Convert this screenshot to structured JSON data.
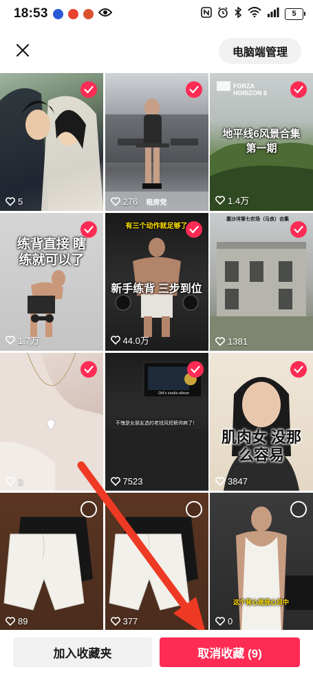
{
  "status_bar": {
    "time": "18:53",
    "battery": "5"
  },
  "header": {
    "close_icon": "close-icon",
    "pc_manage_label": "电脑端管理"
  },
  "grid": {
    "items": [
      {
        "likes": "5",
        "checked": true,
        "caption": ""
      },
      {
        "likes": "276",
        "checked": true,
        "caption": "租房党"
      },
      {
        "likes": "1.4万",
        "checked": true,
        "caption": "地平线6风景合集 第一期",
        "logo_text": "FORZA HORIZON 6"
      },
      {
        "likes": "1.7万",
        "checked": true,
        "caption": "练背直接 瞎练就可以了"
      },
      {
        "likes": "44.0万",
        "checked": true,
        "caption": "新手练背 三步到位",
        "top_caption": "有三个动作就足够了"
      },
      {
        "likes": "1381",
        "checked": true,
        "caption": "惠沙洋第七农场（马良）合集"
      },
      {
        "likes": "3",
        "checked": true,
        "caption": ""
      },
      {
        "likes": "7523",
        "checked": true,
        "caption": "不愧是女朋友选的老钱风短裤帅麻了！",
        "small_text": "Old's studio album"
      },
      {
        "likes": "3847",
        "checked": true,
        "caption": "肌肉女 没那么容易"
      },
      {
        "likes": "89",
        "checked": false,
        "caption": ""
      },
      {
        "likes": "377",
        "checked": false,
        "caption": ""
      },
      {
        "likes": "0",
        "checked": false,
        "caption": "这个背心是我心目中"
      }
    ]
  },
  "bottom_bar": {
    "add_folder_label": "加入收藏夹",
    "cancel_favorite_label": "取消收藏 (9)"
  },
  "colors": {
    "accent": "#fe2c55",
    "button_gray": "#f1f1f2"
  }
}
